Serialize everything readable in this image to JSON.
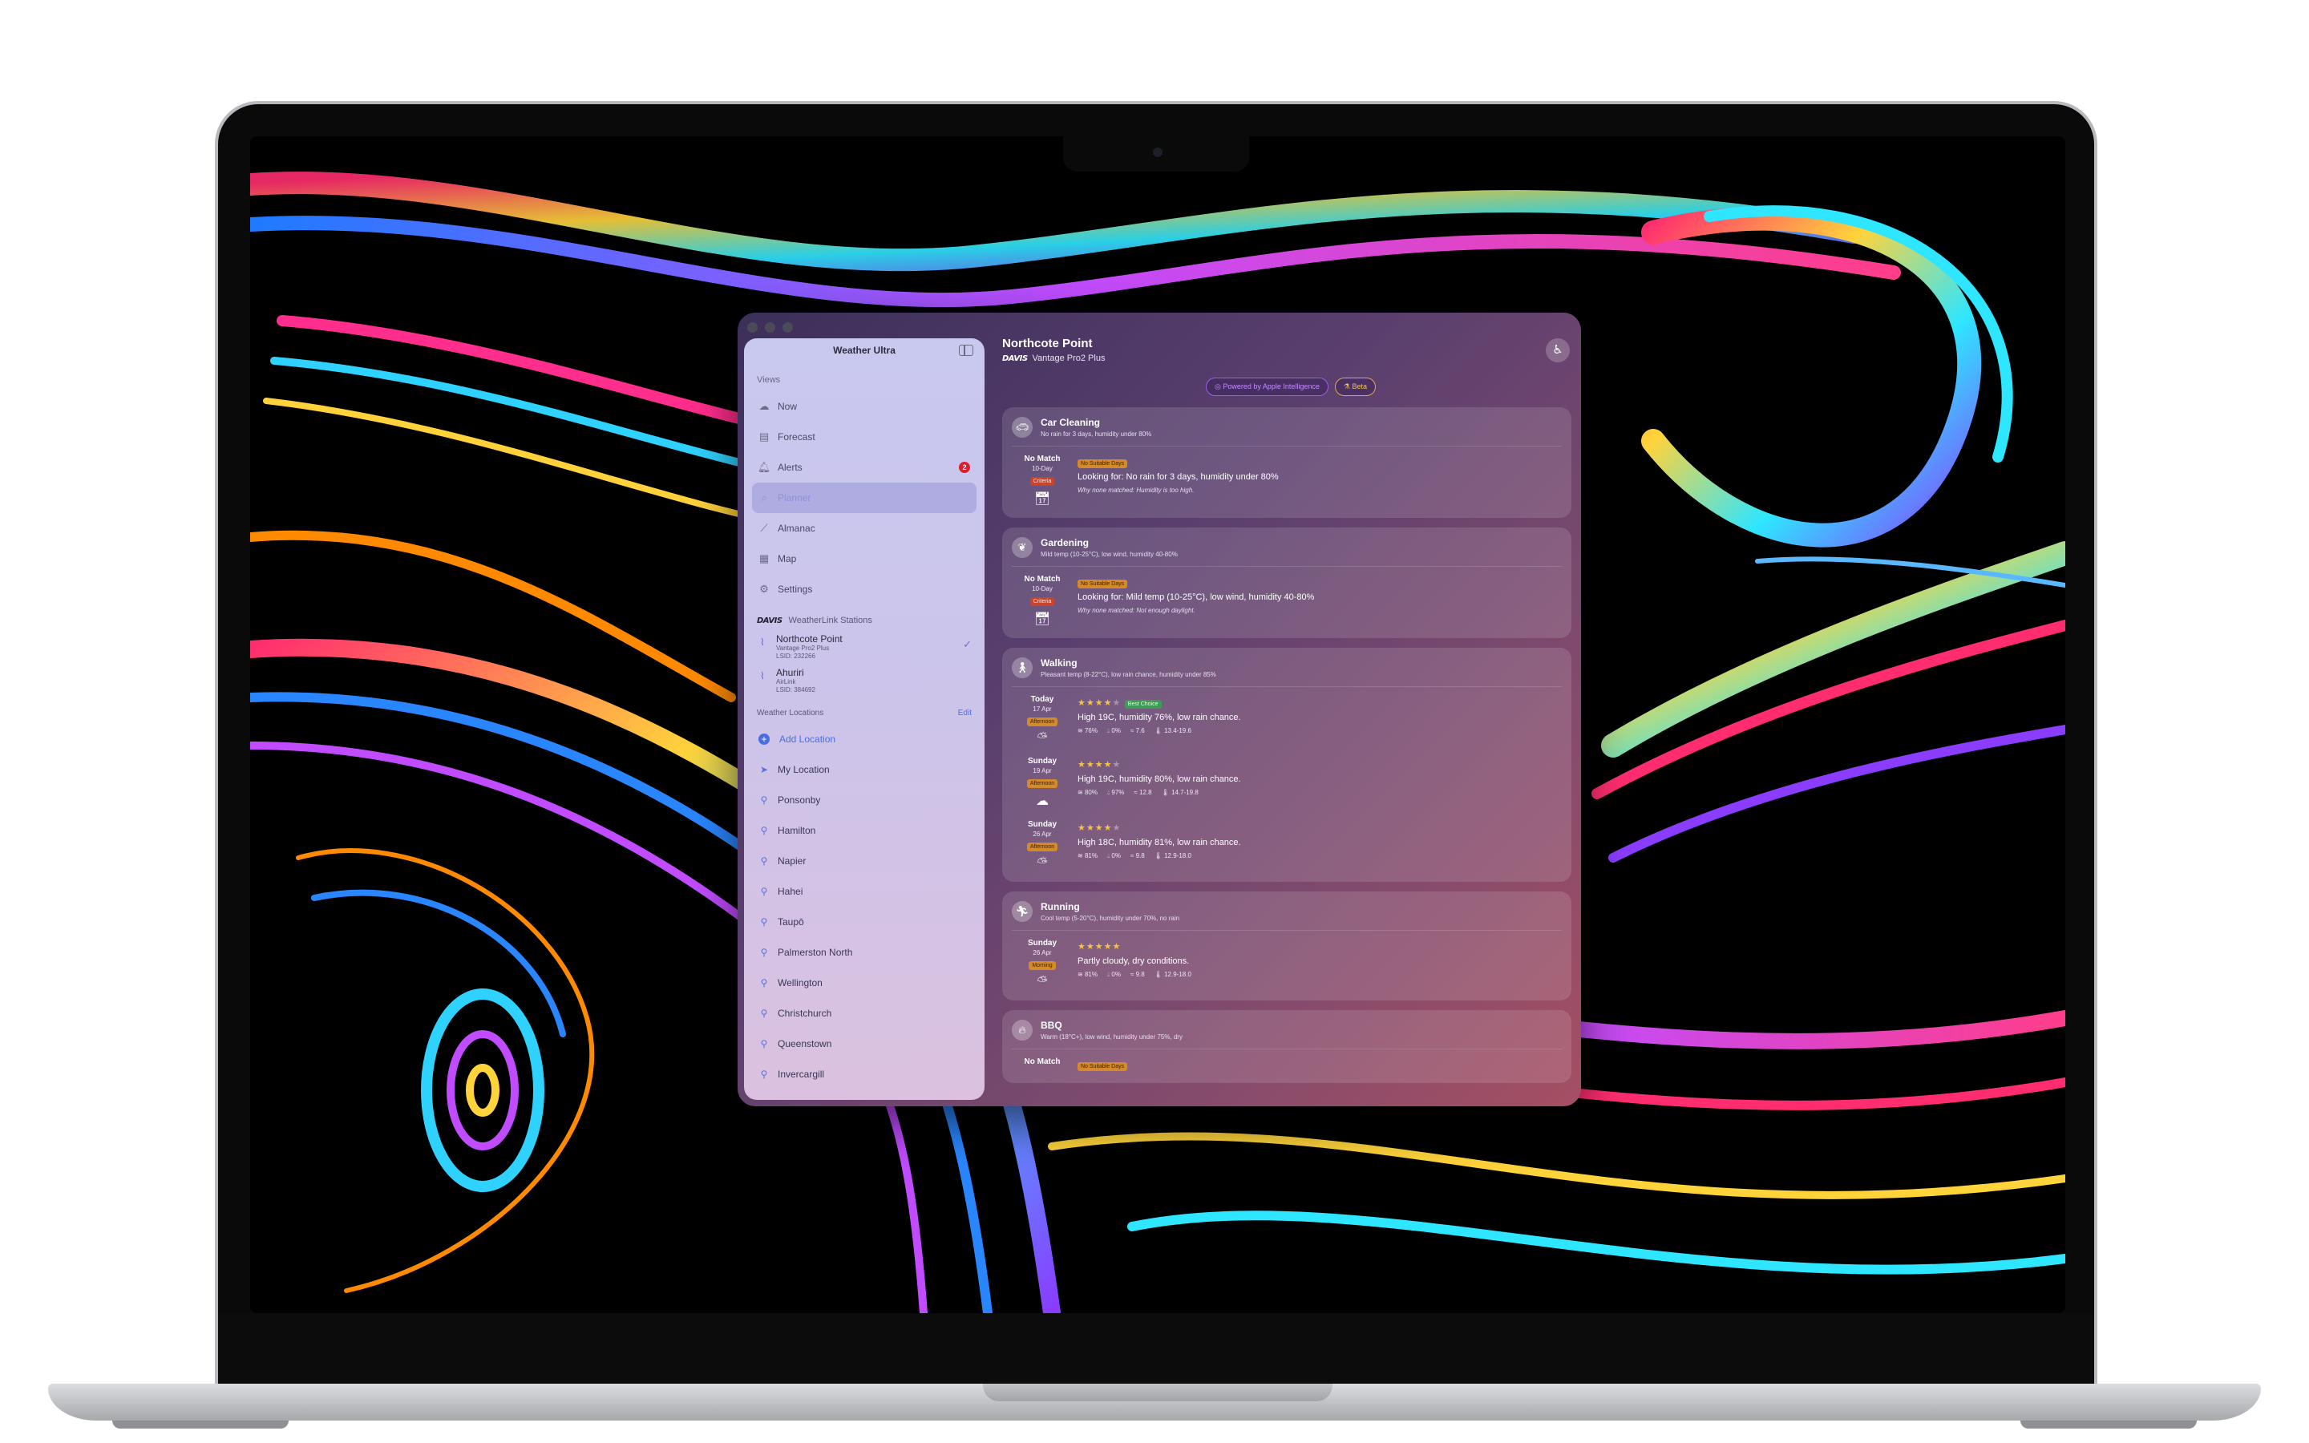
{
  "app": {
    "title": "Weather Ultra"
  },
  "sidebar": {
    "views_label": "Views",
    "items": [
      {
        "label": "Now",
        "icon": "cloud-icon"
      },
      {
        "label": "Forecast",
        "icon": "calendar-icon"
      },
      {
        "label": "Alerts",
        "icon": "bell-icon",
        "badge": "2"
      },
      {
        "label": "Planner",
        "icon": "planner-icon",
        "active": true
      },
      {
        "label": "Almanac",
        "icon": "chart-icon"
      },
      {
        "label": "Map",
        "icon": "map-icon"
      },
      {
        "label": "Settings",
        "icon": "gear-icon"
      }
    ],
    "weatherlink_label": "WeatherLink Stations",
    "brand": "DAVIS",
    "stations": [
      {
        "name": "Northcote Point",
        "model": "Vantage Pro2 Plus",
        "id": "LSID: 232266",
        "selected": true
      },
      {
        "name": "Ahuriri",
        "model": "AirLink",
        "id": "LSID: 384692"
      }
    ],
    "weather_locations_label": "Weather Locations",
    "edit_label": "Edit",
    "add_location": "Add Location",
    "locations": [
      "My Location",
      "Ponsonby",
      "Hamilton",
      "Napier",
      "Hahei",
      "Taupō",
      "Palmerston North",
      "Wellington",
      "Christchurch",
      "Queenstown",
      "Invercargill"
    ]
  },
  "main": {
    "station_name": "Northcote Point",
    "station_brand": "DAVIS",
    "station_model": "Vantage Pro2 Plus",
    "pill_ai": "Powered by Apple Intelligence",
    "pill_beta": "Beta",
    "activities": [
      {
        "title": "Car Cleaning",
        "desc": "No rain for 3 days, humidity under 80%",
        "icon": "car-icon",
        "rows": [
          {
            "d1": "No Match",
            "d2": "10-Day",
            "tag": "Criteria",
            "tag_color": "red",
            "status": "No Suitable Days",
            "status_color": "orange",
            "text": "Looking for: No rain for 3 days, humidity under 80%",
            "why": "Why none matched: Humidity is too high.",
            "wx": "calendar-icon"
          }
        ]
      },
      {
        "title": "Gardening",
        "desc": "Mild temp (10-25°C), low wind, humidity 40-80%",
        "icon": "leaf-icon",
        "rows": [
          {
            "d1": "No Match",
            "d2": "10-Day",
            "tag": "Criteria",
            "tag_color": "red",
            "status": "No Suitable Days",
            "status_color": "orange",
            "text": "Looking for: Mild temp (10-25°C), low wind, humidity 40-80%",
            "why": "Why none matched: Not enough daylight.",
            "wx": "calendar-icon"
          }
        ]
      },
      {
        "title": "Walking",
        "desc": "Pleasant temp (8-22°C), low rain chance, humidity under 85%",
        "icon": "walking-icon",
        "rows": [
          {
            "d1": "Today",
            "d2": "17 Apr",
            "tag": "Afternoon",
            "tag_color": "orange",
            "stars": 4,
            "status": "Best Choice",
            "status_color": "green",
            "text": "High 19C, humidity 76%, low rain chance.",
            "m1": "76%",
            "m2": "0%",
            "m3": "7.6",
            "m4": "13.4-19.6",
            "wx": "partly-sunny-icon"
          },
          {
            "d1": "Sunday",
            "d2": "19 Apr",
            "tag": "Afternoon",
            "tag_color": "orange",
            "stars": 4,
            "text": "High 19C, humidity 80%, low rain chance.",
            "m1": "80%",
            "m2": "97%",
            "m3": "12.8",
            "m4": "14.7-19.8",
            "wx": "cloud-icon"
          },
          {
            "d1": "Sunday",
            "d2": "26 Apr",
            "tag": "Afternoon",
            "tag_color": "orange",
            "stars": 4,
            "text": "High 18C, humidity 81%, low rain chance.",
            "m1": "81%",
            "m2": "0%",
            "m3": "9.8",
            "m4": "12.9-18.0",
            "wx": "partly-sunny-icon"
          }
        ]
      },
      {
        "title": "Running",
        "desc": "Cool temp (5-20°C), humidity under 70%, no rain",
        "icon": "running-icon",
        "rows": [
          {
            "d1": "Sunday",
            "d2": "26 Apr",
            "tag": "Morning",
            "tag_color": "orange",
            "stars": 5,
            "text": "Partly cloudy, dry conditions.",
            "m1": "81%",
            "m2": "0%",
            "m3": "9.8",
            "m4": "12.9-18.0",
            "wx": "partly-sunny-icon"
          }
        ]
      },
      {
        "title": "BBQ",
        "desc": "Warm (18°C+), low wind, humidity under 75%, dry",
        "icon": "flame-icon",
        "rows": [
          {
            "d1": "No Match",
            "status": "No Suitable Days",
            "status_color": "orange"
          }
        ]
      }
    ]
  }
}
